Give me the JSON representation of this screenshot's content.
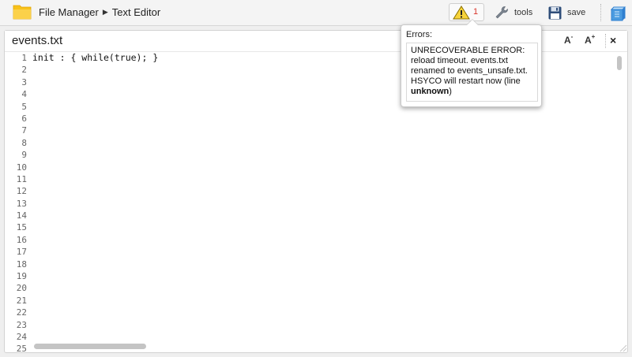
{
  "breadcrumb": {
    "root": "File Manager",
    "current": "Text Editor"
  },
  "toolbar": {
    "error_count": "1",
    "tools_label": "tools",
    "save_label": "save"
  },
  "editor": {
    "file_name": "events.txt",
    "font_smaller_label": "A",
    "font_larger_label": "A",
    "close_label": "×",
    "lines": [
      "init : { while(true); }"
    ],
    "line_numbers": [
      "1",
      "2",
      "3",
      "4",
      "5",
      "6",
      "7",
      "8",
      "9",
      "10",
      "11",
      "12",
      "13",
      "14",
      "15",
      "16",
      "17",
      "18",
      "19",
      "20",
      "21",
      "22",
      "23",
      "24",
      "25"
    ]
  },
  "errors": {
    "heading": "Errors:",
    "message_text": "UNRECOVERABLE ERROR: reload timeout. events.txt renamed to events_unsafe.txt. HSYCO will restart now (line ",
    "message_bold": "unknown",
    "message_end": ")"
  },
  "colors": {
    "folder": "#f8c21b",
    "warning": "#f7d33a",
    "error_count": "#d9342b",
    "cube": "#2f7fd0"
  },
  "icons": [
    "folder-icon",
    "warning-icon",
    "wrench-icon",
    "floppy-disk-icon",
    "cube-icon"
  ]
}
